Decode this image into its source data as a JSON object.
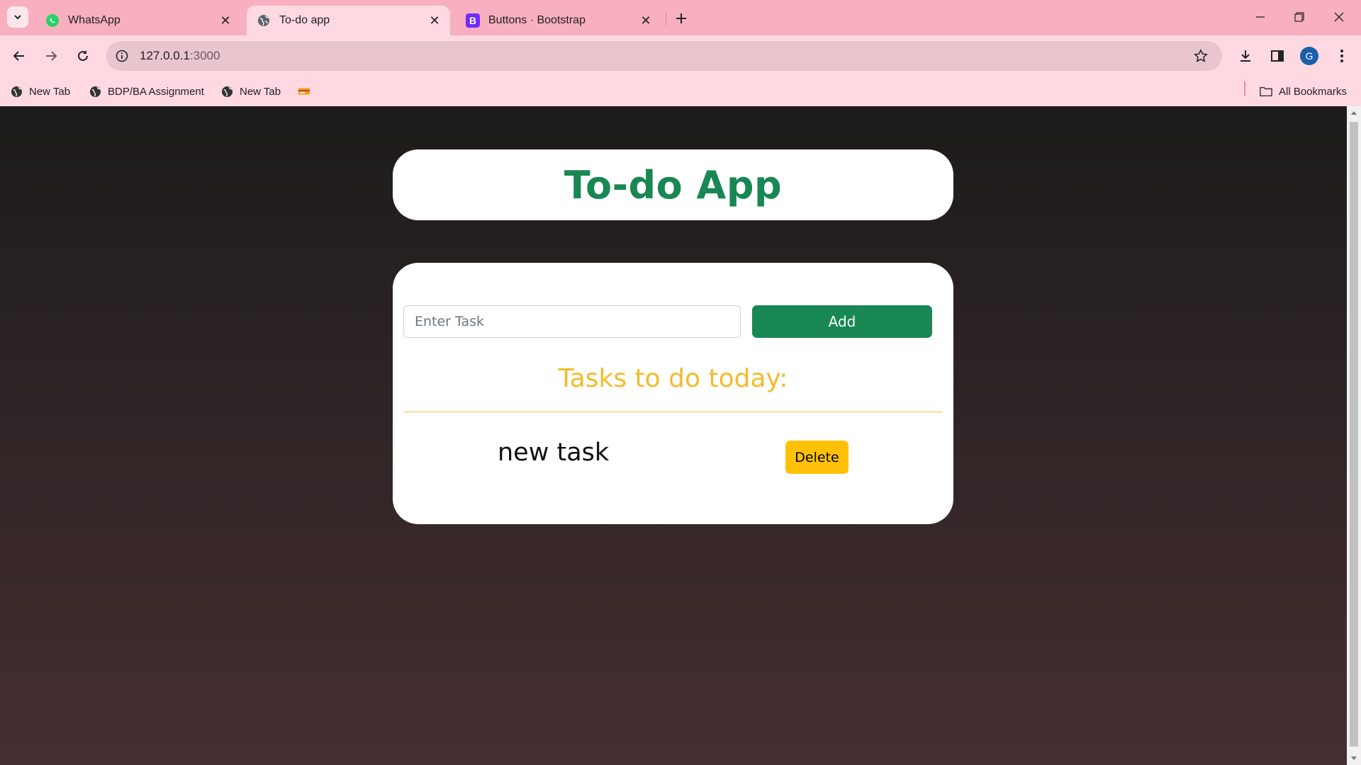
{
  "browser": {
    "tabs": [
      {
        "title": "WhatsApp",
        "icon": "whatsapp-icon",
        "active": false
      },
      {
        "title": "To-do app",
        "icon": "globe-icon",
        "active": true
      },
      {
        "title": "Buttons · Bootstrap",
        "icon": "bootstrap-icon",
        "active": false
      }
    ],
    "url_host": "127.0.0.1",
    "url_port": ":3000",
    "profile_initial": "G",
    "bookmarks": [
      {
        "label": "New Tab",
        "icon": "globe-icon"
      },
      {
        "label": "BDP/BA Assignment",
        "icon": "globe-icon"
      },
      {
        "label": "New Tab",
        "icon": "globe-icon"
      }
    ],
    "all_bookmarks_label": "All Bookmarks"
  },
  "app": {
    "title": "To-do App",
    "input_placeholder": "Enter Task",
    "add_label": "Add",
    "tasks_heading": "Tasks to do today:",
    "tasks": [
      {
        "text": "new task",
        "delete_label": "Delete"
      }
    ]
  },
  "colors": {
    "primary_green": "#198754",
    "heading_yellow": "#f4bb2a",
    "delete_yellow": "#ffc107",
    "chrome_pink": "#f8b0c0"
  }
}
